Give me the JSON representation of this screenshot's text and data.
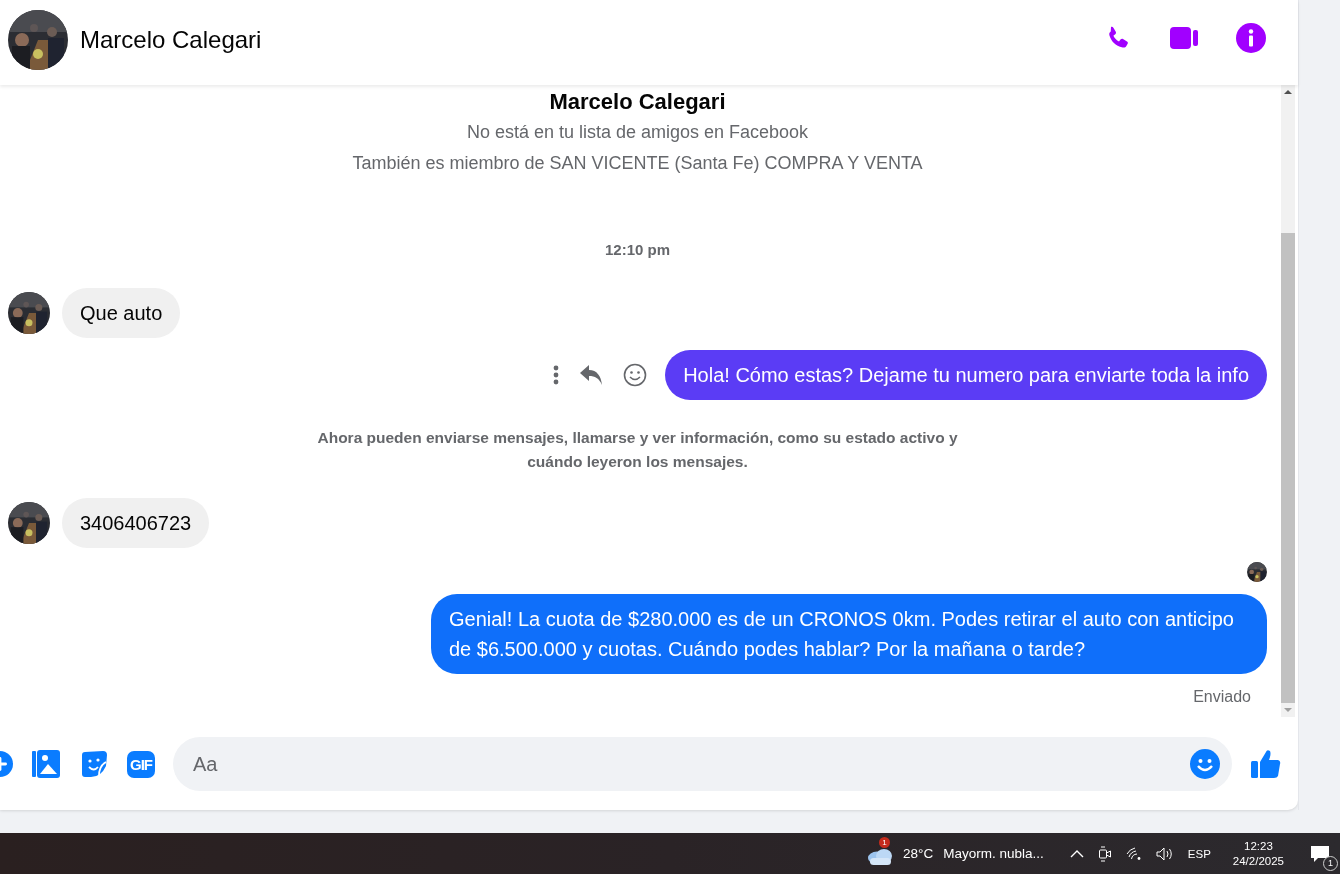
{
  "header": {
    "name": "Marcelo Calegari"
  },
  "intro": {
    "name": "Marcelo Calegari",
    "lines": [
      "No está en tu lista de amigos en Facebook",
      "También es miembro de SAN VICENTE (Santa Fe) COMPRA Y VENTA"
    ]
  },
  "messages": [
    {
      "kind": "time",
      "text": "12:10 pm"
    },
    {
      "kind": "incoming",
      "text": "Que auto"
    },
    {
      "kind": "outgoing",
      "text": "Hola! Cómo estas? Dejame tu numero para enviarte toda la info",
      "color": "#5b3cf5",
      "actions_shown": true,
      "seen": false
    },
    {
      "kind": "system",
      "text": "Ahora pueden enviarse mensajes, llamarse y ver información, como su estado activo y cuándo leyeron los mensajes."
    },
    {
      "kind": "incoming",
      "text": "3406406723"
    },
    {
      "kind": "outgoing",
      "text": "Genial! La cuota de $280.000 es de un CRONOS 0km. Podes retirar el auto con anticipo de $6.500.000 y cuotas. Cuándo podes hablar? Por la mañana o tarde?",
      "color": "#0f6ffa",
      "actions_shown": false,
      "seen": true,
      "status": "Enviado"
    }
  ],
  "composer": {
    "placeholder": "Aa",
    "gif_label": "GIF"
  },
  "taskbar": {
    "weather_badge": "1",
    "temperature": "28°C",
    "weather": "Mayorm. nubla...",
    "language": "ESP",
    "time": "12:23",
    "date": "24/2/2025",
    "notification_count": "1"
  }
}
